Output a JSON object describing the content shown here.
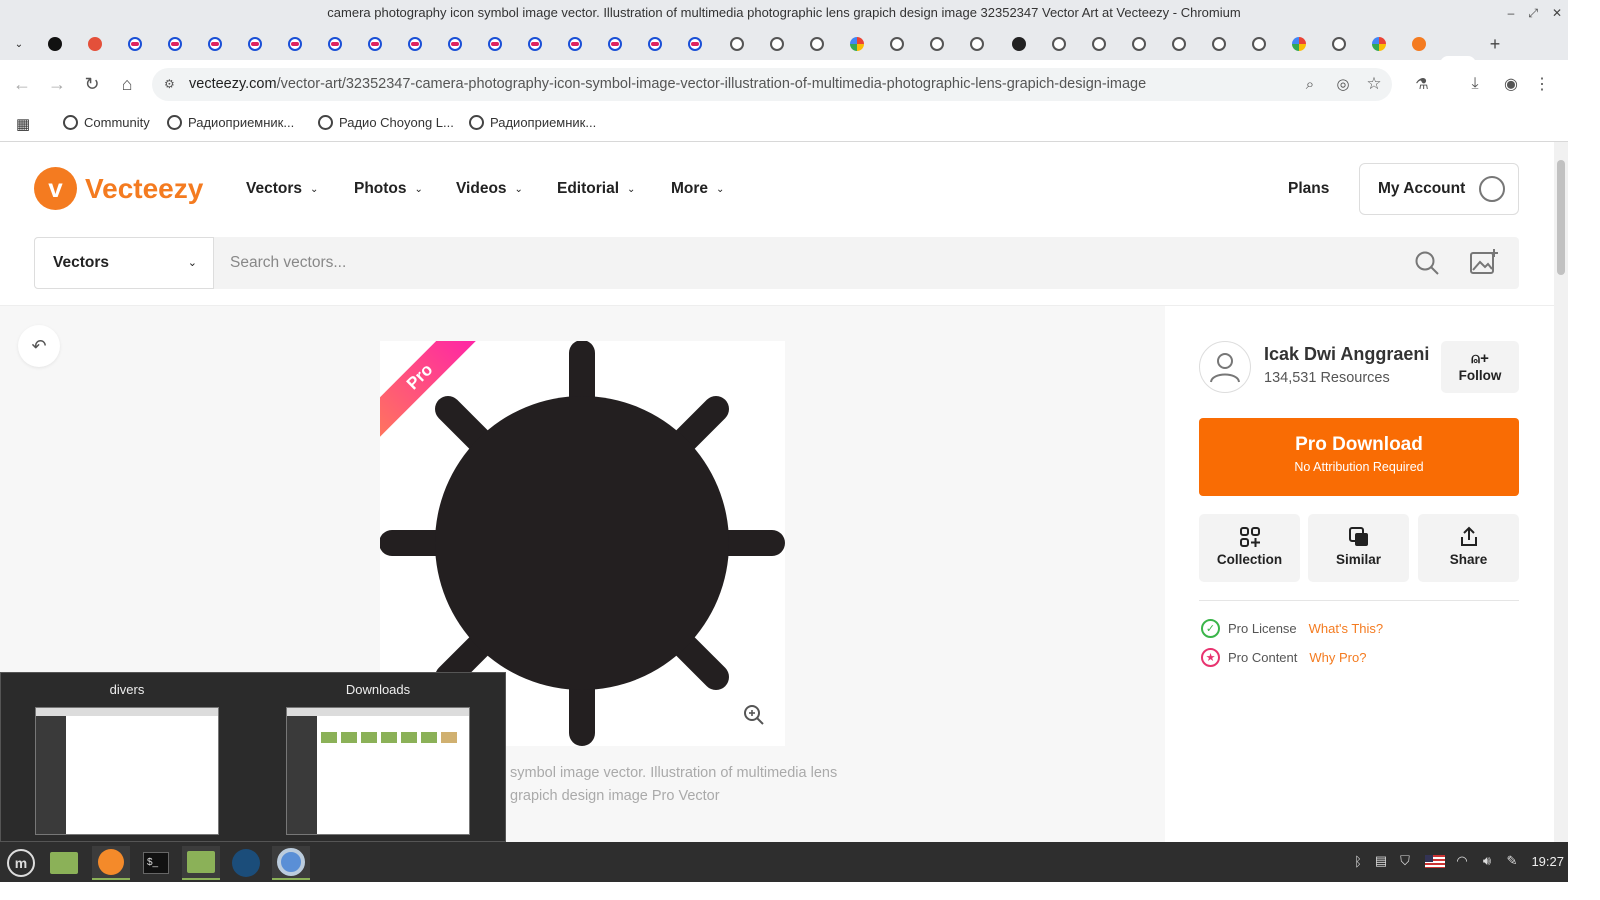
{
  "window": {
    "title": "camera photography icon symbol image vector. Illustration of multimedia photographic lens grapich design image 32352347 Vector Art at Vecteezy - Chromium"
  },
  "browser": {
    "url_domain": "vecteezy.com",
    "url_path": "/vector-art/32352347-camera-photography-icon-symbol-image-vector-illustration-of-multimedia-photographic-lens-grapich-design-image",
    "bookmarks": [
      "Community",
      "Радиоприемник...",
      "Радио Choyong L...",
      "Радиоприемник..."
    ]
  },
  "site": {
    "logo_text": "Vecteezy",
    "nav": [
      "Vectors",
      "Photos",
      "Videos",
      "Editorial",
      "More"
    ],
    "plans": "Plans",
    "account": "My Account",
    "search_type": "Vectors",
    "search_placeholder": "Search vectors..."
  },
  "asset": {
    "badge": "Pro",
    "description": "symbol image vector. Illustration of multimedia lens grapich design image Pro Vector"
  },
  "author": {
    "name": "Icak Dwi Anggraeni",
    "resources": "134,531 Resources",
    "follow": "Follow"
  },
  "download": {
    "label": "Pro Download",
    "sublabel": "No Attribution Required"
  },
  "actions": [
    "Collection",
    "Similar",
    "Share"
  ],
  "license": {
    "line1": "Pro License",
    "link1": "What's This?",
    "line2": "Pro Content",
    "link2": "Why Pro?"
  },
  "switcher": {
    "items": [
      "divers",
      "Downloads"
    ]
  },
  "taskbar": {
    "clock": "19:27"
  },
  "colors": {
    "brand": "#f47b20",
    "pro_download": "#f96c04",
    "license_ok": "#3bb54a",
    "pro_content": "#e8336f"
  }
}
